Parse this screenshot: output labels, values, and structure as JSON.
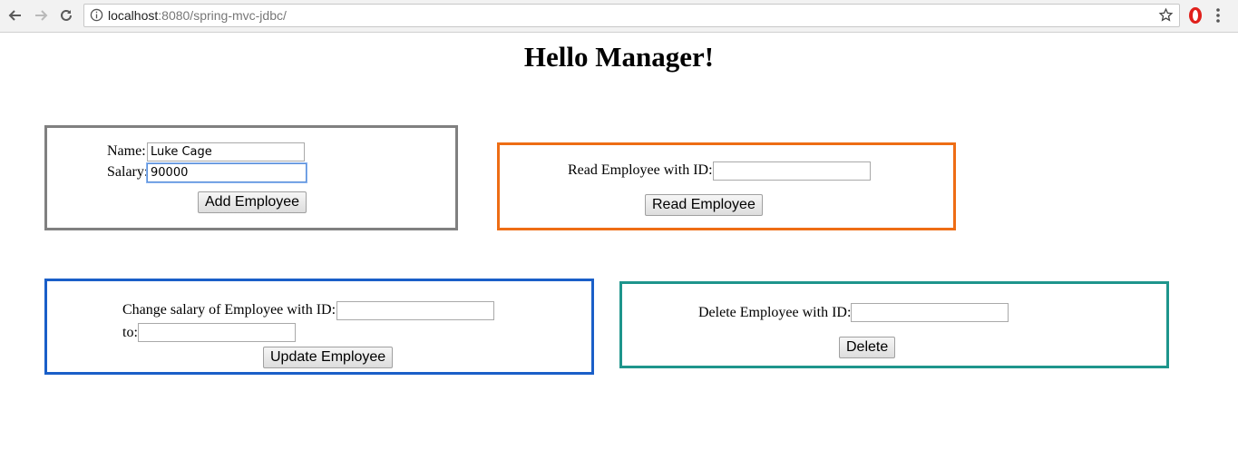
{
  "browser": {
    "url_host": "localhost",
    "url_path": ":8080/spring-mvc-jdbc/"
  },
  "page": {
    "title": "Hello Manager!"
  },
  "add_form": {
    "name_label": "Name:",
    "name_value": "Luke Cage",
    "salary_label": "Salary:",
    "salary_value": "90000",
    "button": "Add Employee",
    "border_color": "#808080"
  },
  "read_form": {
    "id_label": "Read Employee with ID:",
    "id_value": "",
    "button": "Read Employee",
    "border_color": "#ee6d15"
  },
  "update_form": {
    "id_label": "Change salary of Employee with ID:",
    "id_value": "",
    "to_label": "to:",
    "to_value": "",
    "button": "Update Employee",
    "border_color": "#1a5fc8"
  },
  "delete_form": {
    "id_label": "Delete Employee with ID:",
    "id_value": "",
    "button": "Delete",
    "border_color": "#1e958c"
  },
  "icons": [
    "back-icon",
    "forward-icon",
    "reload-icon",
    "info-icon",
    "bookmark-star-icon",
    "opera-icon",
    "menu-icon"
  ]
}
